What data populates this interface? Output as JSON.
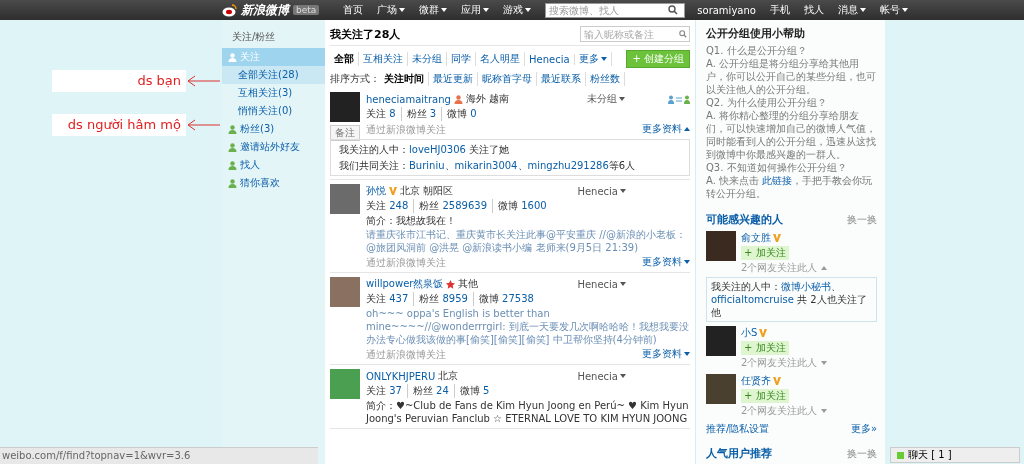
{
  "topbar": {
    "logo": "新浪微博",
    "badge": "beta",
    "nav": [
      {
        "label": "首页",
        "caret": false
      },
      {
        "label": "广场",
        "caret": true
      },
      {
        "label": "微群",
        "caret": true
      },
      {
        "label": "应用",
        "caret": true
      },
      {
        "label": "游戏",
        "caret": true
      }
    ],
    "search": {
      "placeholder": "搜索微博、找人"
    },
    "user": "soramiyano",
    "links": [
      {
        "label": "手机",
        "caret": false
      },
      {
        "label": "找人",
        "caret": false
      },
      {
        "label": "消息",
        "caret": true
      },
      {
        "label": "帐号",
        "caret": true
      }
    ]
  },
  "annotations": [
    {
      "text": "ds bạn"
    },
    {
      "text": "ds người hâm mộ"
    }
  ],
  "sidebar": {
    "title": "关注/粉丝",
    "items": [
      {
        "label": "关注",
        "selected": true,
        "children": [
          {
            "label": "全部关注(28)",
            "selected": true
          },
          {
            "label": "互相关注(3)",
            "selected": false
          },
          {
            "label": "悄悄关注(0)",
            "selected": false
          }
        ]
      },
      {
        "label": "粉丝(3)",
        "selected": false
      },
      {
        "label": "邀请站外好友",
        "selected": false
      },
      {
        "label": "找人",
        "selected": false
      },
      {
        "label": "猜你喜欢",
        "selected": false
      }
    ]
  },
  "main": {
    "heading": "我关注了28人",
    "search": {
      "placeholder": "输入昵称或备注"
    },
    "filters": [
      {
        "label": "全部",
        "selected": true,
        "caret": false
      },
      {
        "label": "互相关注",
        "selected": false,
        "caret": false
      },
      {
        "label": "未分组",
        "selected": false,
        "caret": false
      },
      {
        "label": "同学",
        "selected": false,
        "caret": false
      },
      {
        "label": "名人明星",
        "selected": false,
        "caret": false
      },
      {
        "label": "Henecia",
        "selected": false,
        "caret": false
      },
      {
        "label": "更多",
        "selected": false,
        "caret": true
      }
    ],
    "create_button": "+ 创建分组",
    "sort_label": "排序方式：",
    "sort_options": [
      {
        "label": "关注时间",
        "selected": true
      },
      {
        "label": "最近更新",
        "selected": false
      },
      {
        "label": "昵称首字母",
        "selected": false
      },
      {
        "label": "最近联系",
        "selected": false
      },
      {
        "label": "粉丝数",
        "selected": false
      }
    ],
    "users": [
      {
        "name": "heneciamaitrang",
        "kind": "female",
        "location": "海外 越南",
        "group": "未分组",
        "mutual": true,
        "stats": [
          {
            "label": "关注",
            "value": "8"
          },
          {
            "label": "粉丝",
            "value": "3"
          },
          {
            "label": "微博",
            "value": "0"
          }
        ],
        "remark": "备注",
        "via": "通过新浪微博关注",
        "more": "更多资料",
        "expanded": true,
        "detail": [
          [
            {
              "kind": "text",
              "text": "我关注的人中："
            },
            {
              "kind": "link",
              "text": "loveHJ0306"
            },
            {
              "kind": "text",
              "text": " 关注了她"
            }
          ],
          [
            {
              "kind": "text",
              "text": "我们共同关注："
            },
            {
              "kind": "link",
              "text": "Buriniu"
            },
            {
              "kind": "text",
              "text": "、"
            },
            {
              "kind": "link",
              "text": "mikarin3004"
            },
            {
              "kind": "text",
              "text": "、"
            },
            {
              "kind": "link",
              "text": "mingzhu291286"
            },
            {
              "kind": "text",
              "text": "等6人"
            }
          ]
        ]
      },
      {
        "name": "孙悦",
        "kind": "verified",
        "location": "北京 朝阳区",
        "group": "Henecia",
        "mutual": false,
        "stats": [
          {
            "label": "关注",
            "value": "248"
          },
          {
            "label": "粉丝",
            "value": "2589639"
          },
          {
            "label": "微博",
            "value": "1600"
          }
        ],
        "intro": "简介：我想故我在！",
        "post": "请重庆张市江书记、重庆黄市长关注此事@平安重庆 //@新浪的小老板：@旅团风洞前 @洪晃 @新浪读书小编 老师来(9月5日 21:39)",
        "via": "通过新浪微博关注",
        "more": "更多资料",
        "expanded": false
      },
      {
        "name": "willpower然泉饭",
        "kind": "star",
        "location": "其他",
        "group": "Henecia",
        "mutual": false,
        "stats": [
          {
            "label": "关注",
            "value": "437"
          },
          {
            "label": "粉丝",
            "value": "8959"
          },
          {
            "label": "微博",
            "value": "27538"
          }
        ],
        "post": "oh~~~ oppa's English is better than mine~~~~//@wonderrrgirl: 到底一天要发几次啊哈哈哈！我想我要没办法专心做我该做的事[偷笑][偷笑][偷笑] 中卫帮你坚持(4分钟前)",
        "via": "通过新浪微博关注",
        "more": "更多资料",
        "expanded": false
      },
      {
        "name": "ONLYKHJPERU",
        "kind": "plain",
        "location": "北京",
        "group": "Henecia",
        "mutual": false,
        "stats": [
          {
            "label": "关注",
            "value": "37"
          },
          {
            "label": "粉丝",
            "value": "24"
          },
          {
            "label": "微博",
            "value": "5"
          }
        ],
        "intro": "简介：♥~Club de Fans de Kim Hyun Joong en Perú~ ♥ Kim Hyun Joong's Peruvian Fanclub ☆ ETERNAL LOVE TO KIM HYUN JOONG"
      }
    ]
  },
  "help": {
    "title": "公开分组使用小帮助",
    "paragraphs": [
      [
        {
          "kind": "text",
          "text": "Q1. 什么是公开分组？"
        }
      ],
      [
        {
          "kind": "text",
          "text": "A. 公开分组是将分组分享给其他用户，你可以公开自己的某些分组，也可以关注他人的公开分组。"
        }
      ],
      [
        {
          "kind": "text",
          "text": "Q2. 为什么使用公开分组？"
        }
      ],
      [
        {
          "kind": "text",
          "text": "A. 将你精心整理的分组分享给朋友们，可以快速增加自己的微博人气值，同时能看到人的公开分组，迅速从这找到微博中你最感兴趣的一群人。"
        }
      ],
      [
        {
          "kind": "text",
          "text": "Q3. 不知道如何操作公开分组？"
        }
      ],
      [
        {
          "kind": "text",
          "text": "A. 快来点击 "
        },
        {
          "kind": "link",
          "text": "此链接"
        },
        {
          "kind": "text",
          "text": "，手把手教会你玩转公开分组。"
        }
      ]
    ]
  },
  "suggestions": {
    "title": "可能感兴趣的人",
    "refresh": "换一换",
    "people": [
      {
        "name": "俞文胜",
        "follow": "+ 加关注",
        "note": "2个网友关注此人",
        "expanded": true,
        "detail": [
          {
            "kind": "text",
            "text": "我关注的人中："
          },
          {
            "kind": "link",
            "text": "微博小秘书"
          },
          {
            "kind": "text",
            "text": "、"
          },
          {
            "kind": "link",
            "text": "officialtomcruise"
          },
          {
            "kind": "text",
            "text": " 共 2人也关注了他"
          }
        ]
      },
      {
        "name": "小S",
        "follow": "+ 加关注",
        "note": "2个网友关注此人",
        "expanded": false
      },
      {
        "name": "任贤齐",
        "follow": "+ 加关注",
        "note": "2个网友关注此人",
        "expanded": false
      }
    ],
    "settings": "推荐/隐私设置",
    "more": "更多»"
  },
  "popular": {
    "title": "人气用户推荐",
    "refresh": "换一换"
  },
  "status_bar": "weibo.com/f/find?topnav=1&wvr=3.6",
  "chat": {
    "label": "聊天 [ 1 ]"
  }
}
